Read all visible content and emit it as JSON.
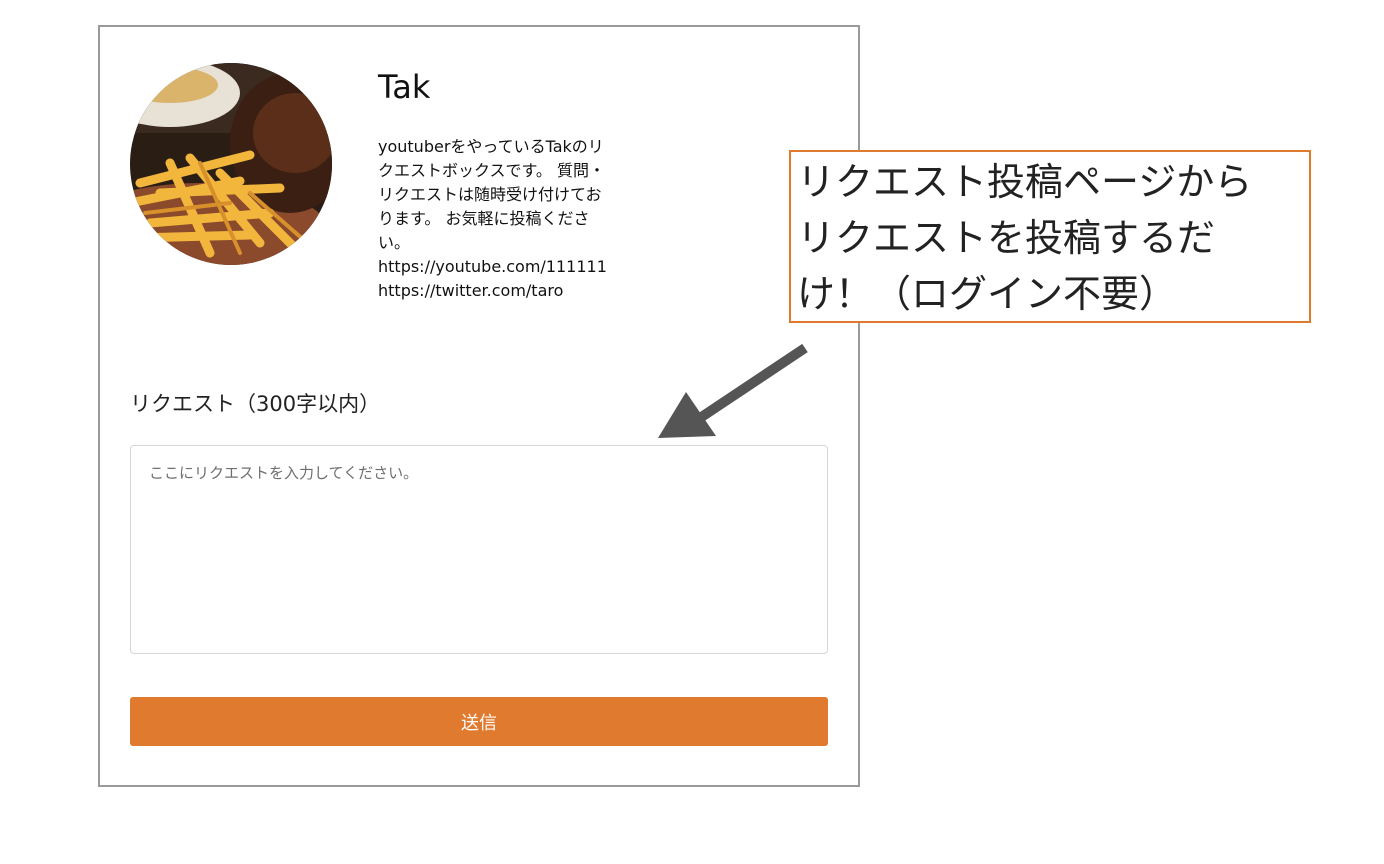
{
  "profile": {
    "name": "Tak",
    "bio_lines": [
      "youtuberをやっているTakのリ",
      "クエストボックスです。 質問・",
      "リクエストは随時受け付けてお",
      "ります。 お気軽に投稿くださ",
      "い。",
      "https://youtube.com/111111",
      "https://twitter.com/taro"
    ]
  },
  "form": {
    "label": "リクエスト（300字以内）",
    "placeholder": "ここにリクエストを入力してください。",
    "value": "",
    "submit_label": "送信"
  },
  "annotation": {
    "lines": [
      "リクエスト投稿ページから",
      "リクエストを投稿するだ",
      "け！（ログイン不要）"
    ],
    "border_color": "#e07a2e",
    "arrow_color": "#555555",
    "arrow_icon": "arrow-down-left-icon"
  },
  "colors": {
    "accent": "#e07a2e",
    "card_border": "#9a9a9a"
  }
}
